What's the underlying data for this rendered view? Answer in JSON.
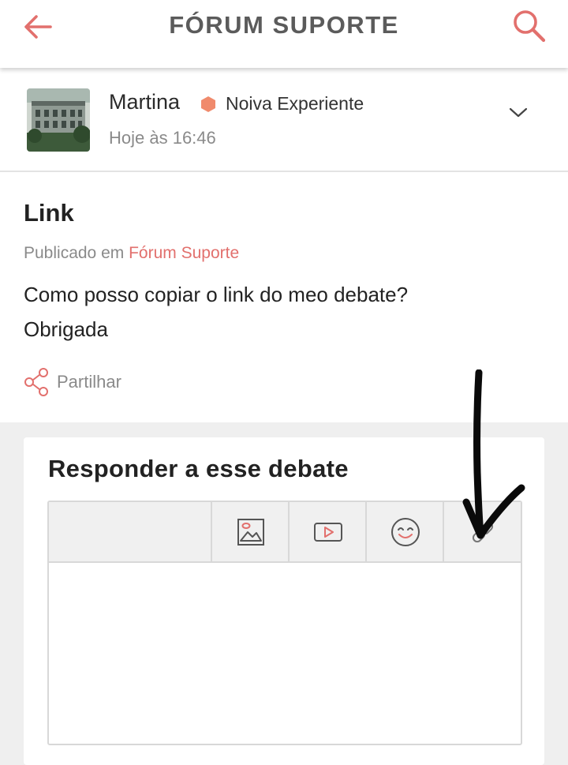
{
  "appbar": {
    "title": "FÓRUM SUPORTE",
    "back_icon": "arrow-left-icon",
    "search_icon": "search-icon",
    "accent": "#e2706d"
  },
  "author": {
    "name": "Martina",
    "rank": "Noiva Experiente",
    "rank_color": "#f08a6c",
    "time": "Hoje às 16:46"
  },
  "post": {
    "title": "Link",
    "published_prefix": "Publicado em",
    "published_link": "Fórum Suporte",
    "body_lines": [
      "Como posso copiar o link do meo debate?",
      "Obrigada"
    ],
    "share_label": "Partilhar"
  },
  "reply": {
    "heading": "Responder a esse debate",
    "toolbar_icons": [
      "image-icon",
      "video-icon",
      "emoji-icon",
      "link-icon"
    ]
  }
}
